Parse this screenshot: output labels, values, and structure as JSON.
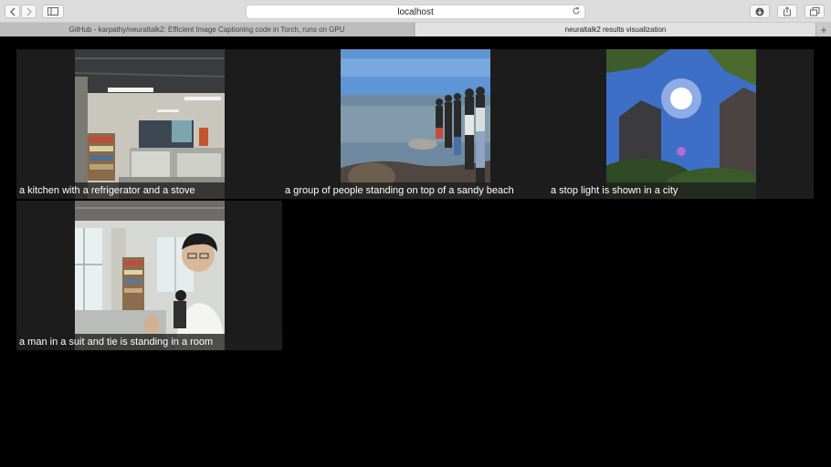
{
  "browser": {
    "url": "localhost",
    "tabs": [
      {
        "label": "GitHub - karpathy/neuraltalk2: Efficient Image Captioning code in Torch, runs on GPU",
        "active": false
      },
      {
        "label": "neuraltalk2 results visualization",
        "active": true
      }
    ],
    "icons": [
      "back-icon",
      "forward-icon",
      "sidebar-icon",
      "reload-icon",
      "download-icon",
      "share-icon",
      "tabs-overview-icon",
      "new-tab-icon"
    ]
  },
  "results": [
    {
      "caption": "a kitchen with a refrigerator and a stove",
      "scene": "office"
    },
    {
      "caption": "a group of people standing on top of a sandy beach",
      "scene": "beach"
    },
    {
      "caption": "a stop light is shown in a city",
      "scene": "city"
    },
    {
      "caption": "a man in a suit and tie is standing in a room",
      "scene": "selfie"
    }
  ],
  "colors": {
    "page_bg": "#000000",
    "card_bg": "#1c1c1c",
    "caption_text": "#ffffff"
  }
}
